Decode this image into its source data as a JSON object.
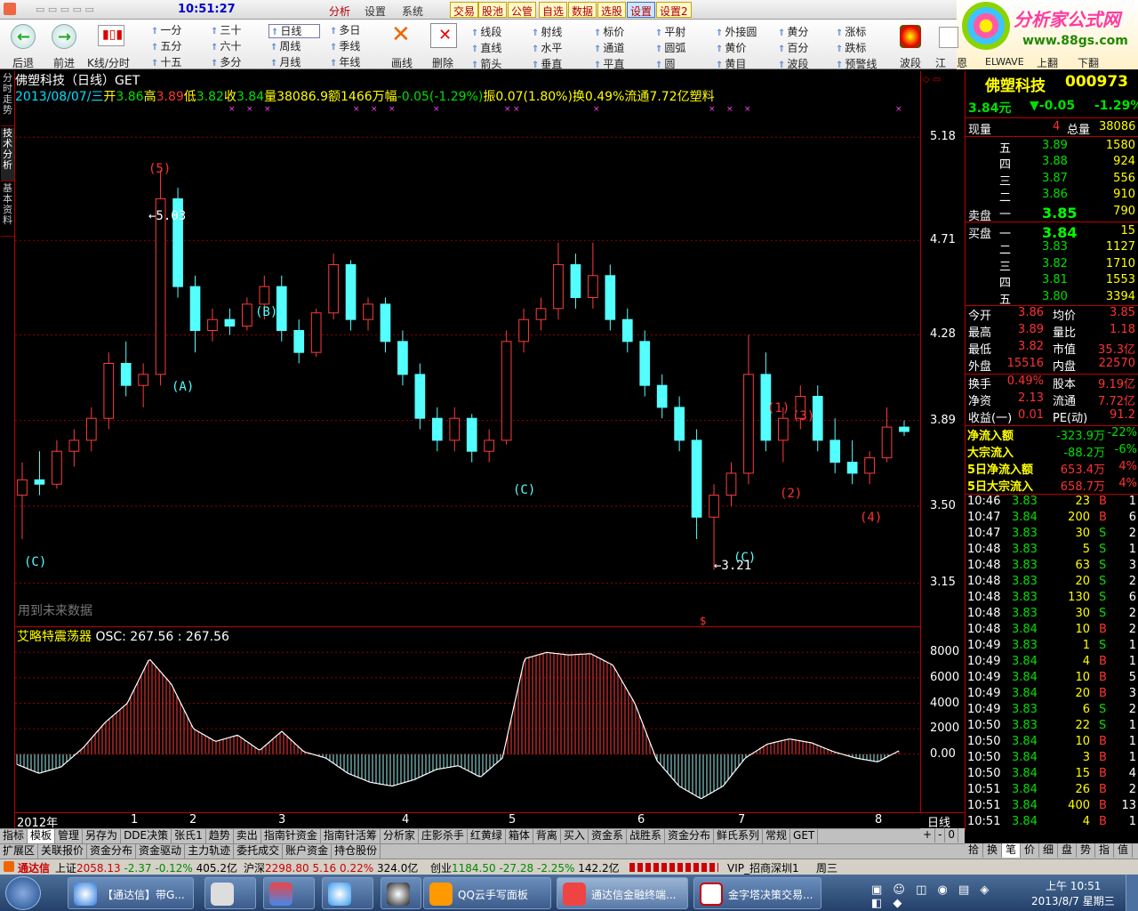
{
  "topbar": {
    "clock": "10:51:27",
    "menus": [
      "分析",
      "设置",
      "系统"
    ],
    "buttons": [
      "交易",
      "股池",
      "公管",
      "自选",
      "数据",
      "选股",
      "设置",
      "设置2"
    ]
  },
  "logo": {
    "text": "分析家公式网",
    "url": "www.88gs.com"
  },
  "toolbar": {
    "nav": [
      {
        "label": "后退"
      },
      {
        "label": "前进"
      },
      {
        "label": "K线/分时"
      }
    ],
    "periods": [
      [
        "一分",
        "三十",
        "日线",
        "多日"
      ],
      [
        "五分",
        "六十",
        "周线",
        "季线"
      ],
      [
        "十五",
        "多分",
        "月线",
        "年线"
      ]
    ],
    "draw": [
      "画线",
      "删除"
    ],
    "lines": [
      [
        "线段",
        "射线",
        "标价",
        "平射",
        "外接圆",
        "黄分",
        "涨标"
      ],
      [
        "直线",
        "水平",
        "通道",
        "圆弧",
        "黄价",
        "百分",
        "跌标"
      ],
      [
        "箭头",
        "垂直",
        "平直",
        "圆",
        "黄目",
        "波段",
        "预警线"
      ]
    ],
    "right": [
      "波段",
      "江",
      "恩",
      "ELWAVE",
      "上翻",
      "下翻"
    ]
  },
  "leftstrip": [
    "分时走势",
    "技术分析",
    "基本资料"
  ],
  "header": {
    "line1": "佛塑科技（日线）GET",
    "date": "2013/08/07/三",
    "open_l": "开",
    "open": "3.86",
    "high_l": "高",
    "high": "3.89",
    "low_l": "低",
    "low": "3.82",
    "close_l": "收",
    "close": "3.84",
    "vol_l": "量",
    "vol": "38086.9",
    "amt_l": "额",
    "amt": "1466万",
    "chg_l": "幅",
    "chg": "-0.05(-1.29%)",
    "amp_l": "振",
    "amp": "0.07(1.80%)",
    "turn_l": "换",
    "turn": "0.49%",
    "float_l": "流通",
    "float": "7.72亿",
    "industry": "塑料"
  },
  "chart": {
    "watermark": "用到未来数据",
    "wave_labels": [
      "(5)",
      "(A)",
      "(B)",
      "(C)",
      "(C)",
      "(C)",
      "(1)",
      "(2)",
      "(3)",
      "(4)"
    ],
    "price_marks": [
      "5.03",
      "3.21"
    ],
    "dollar": "$",
    "yaxis": [
      "5.18",
      "4.71",
      "4.28",
      "3.89",
      "3.50",
      "3.15"
    ],
    "osc_title": "艾略特震荡器",
    "osc_value": "OSC: 267.56 : 267.56",
    "osc_axis": [
      "8000",
      "6000",
      "4000",
      "2000",
      "0.00"
    ],
    "date_axis": [
      "2012年",
      "1",
      "2",
      "3",
      "4",
      "5",
      "6",
      "7",
      "8"
    ],
    "period": "日线"
  },
  "chart_data": {
    "type": "candlestick",
    "title": "佛塑科技（日线）",
    "ylim": [
      3.05,
      5.4
    ],
    "yticks": [
      5.18,
      4.71,
      4.28,
      3.89,
      3.5,
      3.15
    ],
    "ohlc": [
      [
        3.55,
        3.7,
        3.35,
        3.62
      ],
      [
        3.62,
        3.75,
        3.55,
        3.6
      ],
      [
        3.6,
        3.8,
        3.58,
        3.75
      ],
      [
        3.75,
        3.85,
        3.68,
        3.8
      ],
      [
        3.8,
        3.95,
        3.75,
        3.9
      ],
      [
        3.9,
        4.2,
        3.85,
        4.15
      ],
      [
        4.15,
        4.25,
        4.0,
        4.05
      ],
      [
        4.05,
        4.15,
        3.95,
        4.1
      ],
      [
        4.1,
        5.03,
        4.05,
        4.9
      ],
      [
        4.9,
        4.95,
        4.45,
        4.5
      ],
      [
        4.5,
        4.55,
        4.2,
        4.3
      ],
      [
        4.3,
        4.4,
        4.25,
        4.35
      ],
      [
        4.35,
        4.4,
        4.28,
        4.32
      ],
      [
        4.32,
        4.45,
        4.3,
        4.42
      ],
      [
        4.42,
        4.55,
        4.35,
        4.5
      ],
      [
        4.5,
        4.55,
        4.25,
        4.3
      ],
      [
        4.3,
        4.35,
        4.15,
        4.2
      ],
      [
        4.2,
        4.4,
        4.18,
        4.38
      ],
      [
        4.38,
        4.65,
        4.35,
        4.6
      ],
      [
        4.6,
        4.62,
        4.3,
        4.35
      ],
      [
        4.35,
        4.45,
        4.3,
        4.42
      ],
      [
        4.42,
        4.45,
        4.2,
        4.25
      ],
      [
        4.25,
        4.3,
        4.05,
        4.1
      ],
      [
        4.1,
        4.15,
        3.85,
        3.9
      ],
      [
        3.9,
        3.95,
        3.75,
        3.8
      ],
      [
        3.8,
        3.95,
        3.75,
        3.9
      ],
      [
        3.9,
        3.92,
        3.7,
        3.75
      ],
      [
        3.75,
        3.85,
        3.7,
        3.8
      ],
      [
        3.8,
        4.3,
        3.78,
        4.25
      ],
      [
        4.25,
        4.4,
        4.2,
        4.35
      ],
      [
        4.35,
        4.45,
        4.3,
        4.4
      ],
      [
        4.4,
        4.7,
        4.35,
        4.6
      ],
      [
        4.6,
        4.65,
        4.4,
        4.45
      ],
      [
        4.45,
        4.7,
        4.4,
        4.55
      ],
      [
        4.55,
        4.6,
        4.3,
        4.35
      ],
      [
        4.35,
        4.4,
        4.2,
        4.25
      ],
      [
        4.25,
        4.3,
        4.0,
        4.05
      ],
      [
        4.05,
        4.1,
        3.9,
        3.95
      ],
      [
        3.95,
        4.0,
        3.75,
        3.8
      ],
      [
        3.8,
        3.85,
        3.35,
        3.45
      ],
      [
        3.45,
        3.6,
        3.21,
        3.55
      ],
      [
        3.55,
        3.7,
        3.5,
        3.65
      ],
      [
        3.65,
        4.28,
        3.6,
        4.1
      ],
      [
        4.1,
        4.2,
        3.75,
        3.8
      ],
      [
        3.8,
        3.95,
        3.7,
        3.9
      ],
      [
        3.9,
        4.05,
        3.85,
        4.0
      ],
      [
        4.0,
        4.05,
        3.75,
        3.8
      ],
      [
        3.8,
        3.9,
        3.65,
        3.7
      ],
      [
        3.7,
        3.8,
        3.6,
        3.65
      ],
      [
        3.65,
        3.75,
        3.6,
        3.72
      ],
      [
        3.72,
        3.95,
        3.7,
        3.86
      ],
      [
        3.86,
        3.89,
        3.82,
        3.84
      ]
    ],
    "osc_series": [
      -800,
      -1500,
      -1000,
      500,
      2500,
      4000,
      7500,
      5500,
      2000,
      1000,
      1500,
      300,
      1800,
      200,
      -300,
      -1500,
      -2200,
      -2500,
      -2000,
      -1200,
      -900,
      -1800,
      -300,
      7500,
      8000,
      7800,
      7900,
      7000,
      4000,
      -500,
      -2500,
      -3500,
      -2500,
      -300,
      800,
      1200,
      900,
      200,
      -300,
      -600,
      300
    ],
    "osc_ylim": [
      -4000,
      9000
    ]
  },
  "quote": {
    "name": "佛塑科技",
    "code": "000973",
    "price": "3.84元",
    "chg": "▼-0.05",
    "pct": "-1.29%",
    "now_l": "现量",
    "now": "4",
    "tot_l": "总量",
    "tot": "38086",
    "sell": [
      {
        "lv": "五",
        "p": "3.89",
        "v": "1580"
      },
      {
        "lv": "四",
        "p": "3.88",
        "v": "924"
      },
      {
        "lv": "三",
        "p": "3.87",
        "v": "556"
      },
      {
        "lv": "二",
        "p": "3.86",
        "v": "910"
      },
      {
        "lv": "一",
        "p": "3.85",
        "v": "790"
      }
    ],
    "sell_l": "卖盘",
    "buy_l": "买盘",
    "buy": [
      {
        "lv": "一",
        "p": "3.84",
        "v": "15"
      },
      {
        "lv": "二",
        "p": "3.83",
        "v": "1127"
      },
      {
        "lv": "三",
        "p": "3.82",
        "v": "1710"
      },
      {
        "lv": "四",
        "p": "3.81",
        "v": "1553"
      },
      {
        "lv": "五",
        "p": "3.80",
        "v": "3394"
      }
    ],
    "stats": [
      [
        "今开",
        "3.86",
        "均价",
        "3.85"
      ],
      [
        "最高",
        "3.89",
        "量比",
        "1.18"
      ],
      [
        "最低",
        "3.82",
        "市值",
        "35.3亿"
      ],
      [
        "外盘",
        "15516",
        "内盘",
        "22570"
      ]
    ],
    "stats2": [
      [
        "换手",
        "0.49%",
        "股本",
        "9.19亿"
      ],
      [
        "净资",
        "2.13",
        "流通",
        "7.72亿"
      ],
      [
        "收益(一)",
        "0.01",
        "PE(动)",
        "91.2"
      ]
    ],
    "flows": [
      [
        "净流入额",
        "-323.9万",
        "-22%"
      ],
      [
        "大宗流入",
        "-88.2万",
        "-6%"
      ],
      [
        "5日净流入额",
        "653.4万",
        "4%"
      ],
      [
        "5日大宗流入",
        "658.7万",
        "4%"
      ]
    ],
    "ticks": [
      [
        "10:46",
        "3.83",
        "23",
        "B",
        "1"
      ],
      [
        "10:47",
        "3.84",
        "200",
        "B",
        "6"
      ],
      [
        "10:47",
        "3.83",
        "30",
        "S",
        "2"
      ],
      [
        "10:48",
        "3.83",
        "5",
        "S",
        "1"
      ],
      [
        "10:48",
        "3.83",
        "63",
        "S",
        "3"
      ],
      [
        "10:48",
        "3.83",
        "20",
        "S",
        "2"
      ],
      [
        "10:48",
        "3.83",
        "130",
        "S",
        "6"
      ],
      [
        "10:48",
        "3.83",
        "30",
        "S",
        "2"
      ],
      [
        "10:48",
        "3.84",
        "10",
        "B",
        "2"
      ],
      [
        "10:49",
        "3.83",
        "1",
        "S",
        "1"
      ],
      [
        "10:49",
        "3.84",
        "4",
        "B",
        "1"
      ],
      [
        "10:49",
        "3.84",
        "10",
        "B",
        "5"
      ],
      [
        "10:49",
        "3.84",
        "20",
        "B",
        "3"
      ],
      [
        "10:49",
        "3.83",
        "6",
        "S",
        "2"
      ],
      [
        "10:50",
        "3.83",
        "22",
        "S",
        "1"
      ],
      [
        "10:50",
        "3.84",
        "10",
        "B",
        "1"
      ],
      [
        "10:50",
        "3.84",
        "3",
        "B",
        "1"
      ],
      [
        "10:50",
        "3.84",
        "15",
        "B",
        "4"
      ],
      [
        "10:51",
        "3.84",
        "26",
        "B",
        "2"
      ],
      [
        "10:51",
        "3.84",
        "400",
        "B",
        "13"
      ],
      [
        "10:51",
        "3.84",
        "4",
        "B",
        "1"
      ]
    ]
  },
  "tabs1": [
    "指标",
    "模板",
    "管理",
    "另存为",
    "DDE决策",
    "张氏1",
    "趋势",
    "卖出",
    "指南针资金",
    "指南针活筹",
    "分析家",
    "庄影杀手",
    "红黄绿",
    "箱体",
    "背离",
    "买入",
    "资金系",
    "战胜系",
    "资金分布",
    "鲜氏系列",
    "常规",
    "GET"
  ],
  "tabs1_right": [
    "+",
    "-",
    "0"
  ],
  "tabs2": [
    "扩展区",
    "关联报价",
    "资金分布",
    "资金驱动",
    "主力轨迹",
    "委托成交",
    "账户资金",
    "持仓股份"
  ],
  "tabs2_right": [
    "拾",
    "换",
    "笔",
    "价",
    "细",
    "盘",
    "势",
    "指",
    "值"
  ],
  "status": {
    "brand": "通达信",
    "sh_l": "上证",
    "sh": "2058.13",
    "sh_c": "-2.37",
    "sh_p": "-0.12%",
    "sh_a": "405.2亿",
    "sz_l": "沪深",
    "sz": "2298.80",
    "sz_c": "5.16",
    "sz_p": "0.22%",
    "sz_a": "324.0亿",
    "cy_l": "创业",
    "cy": "1184.50",
    "cy_c": "-27.28",
    "cy_p": "-2.25%",
    "cy_a": "142.2亿",
    "vip": "VIP_招商深圳1",
    "day": "周三"
  },
  "taskbar": {
    "tasks": [
      "【通达信】带G...",
      "",
      "",
      "",
      "",
      "QQ云手写面板",
      "通达信金融终端...",
      "金字塔决策交易..."
    ],
    "time": "上午 10:51",
    "date": "2013/8/7 星期三"
  }
}
